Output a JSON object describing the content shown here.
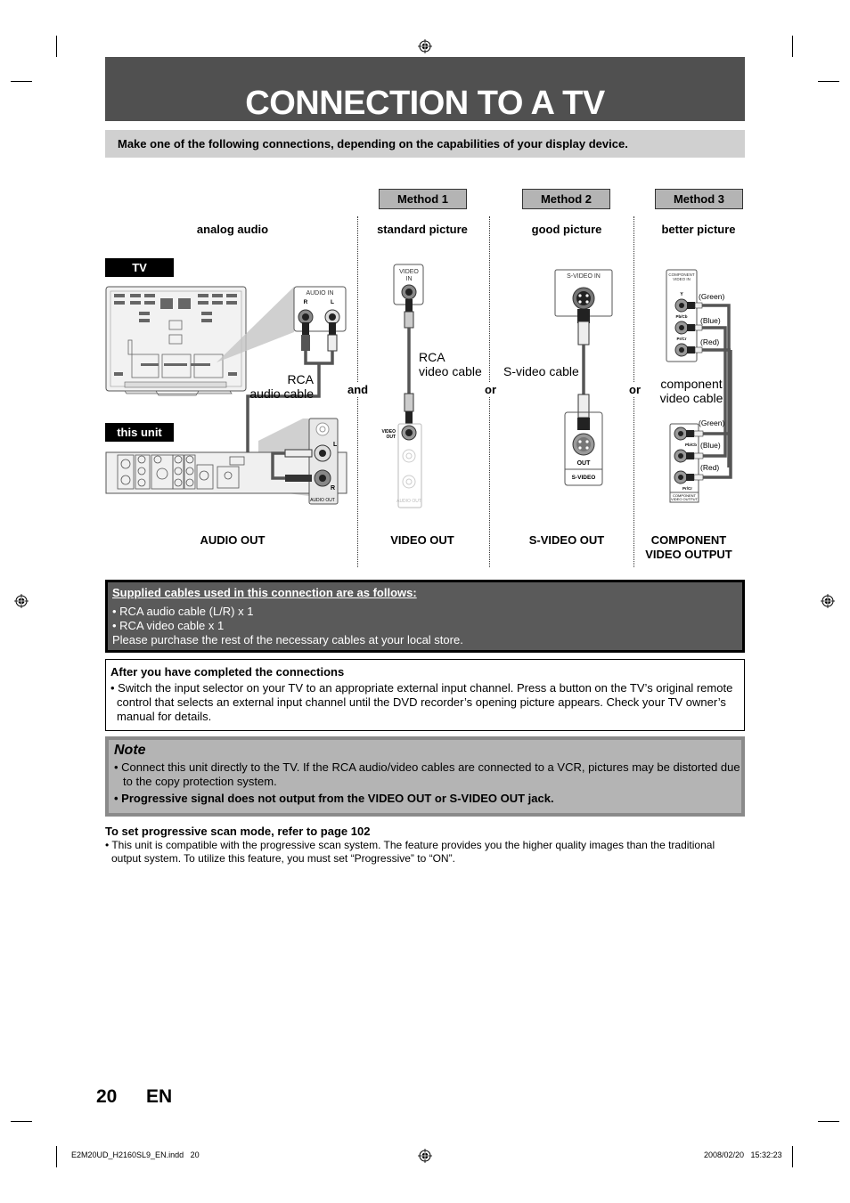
{
  "header": {
    "title": "CONNECTION TO A TV",
    "intro": "Make one of the following connections, depending on the capabilities of your display device."
  },
  "methods": [
    {
      "label": "Method 1",
      "quality": "standard picture",
      "cable": "RCA\nvideo cable",
      "output": "VIDEO OUT"
    },
    {
      "label": "Method 2",
      "quality": "good picture",
      "cable": "S-video cable",
      "output": "S-VIDEO OUT"
    },
    {
      "label": "Method 3",
      "quality": "better picture",
      "cable": "component\nvideo cable",
      "output": "COMPONENT\nVIDEO OUTPUT"
    }
  ],
  "audio": {
    "quality": "analog audio",
    "cable": "RCA\naudio cable",
    "output": "AUDIO OUT"
  },
  "diagram": {
    "tv_label": "TV",
    "unit_label": "this unit",
    "conjunctions": [
      "and",
      "or",
      "or"
    ],
    "jacks": {
      "audio_in": "AUDIO IN",
      "audio_in_r": "R",
      "audio_in_l": "L",
      "audio_out": "AUDIO OUT",
      "video_in_line1": "VIDEO",
      "video_in_line2": "IN",
      "video_out_line1": "VIDEO",
      "video_out_line2": "OUT",
      "svideo_in": "S-VIDEO IN",
      "svideo_out": "OUT",
      "svideo_out_panel": "S-VIDEO",
      "component_in_line1": "COMPONENT",
      "component_in_line2": "VIDEO IN",
      "component_out_line1": "COMPONENT",
      "component_out_line2": "VIDEO OUTPUT",
      "y": "Y",
      "pb": "Pb/Cb",
      "pr": "Pr/Cr",
      "l": "L",
      "r": "R"
    },
    "component_colors": [
      "(Green)",
      "(Blue)",
      "(Red)"
    ]
  },
  "supplied": {
    "heading": "Supplied cables used in this connection are as follows:",
    "items": [
      "• RCA audio cable (L/R) x 1",
      "• RCA video cable x 1"
    ],
    "footer": "Please purchase the rest of the necessary cables at your local store."
  },
  "after": {
    "heading": "After you have completed the connections",
    "text": "• Switch the input selector on your TV to an appropriate external input channel. Press a button on the TV’s original remote control that selects an external input channel until the DVD recorder’s opening picture appears. Check your TV owner’s manual for details."
  },
  "note": {
    "heading": "Note",
    "items": [
      "• Connect this unit directly to the TV. If the RCA audio/video cables are connected to a VCR, pictures may be distorted due to the copy protection system.",
      "• Progressive signal does not output from the VIDEO OUT or S-VIDEO OUT jack."
    ]
  },
  "progressive": {
    "heading": "To set progressive scan mode, refer to page 102",
    "text": "• This unit is compatible with the progressive scan system. The feature provides you the higher quality images than the traditional output system. To utilize this feature, you must set “Progressive” to “ON”."
  },
  "footer": {
    "page_number": "20",
    "language": "EN",
    "file": "E2M20UD_H2160SL9_EN.indd   20",
    "datetime": "2008/02/20   15:32:23"
  }
}
